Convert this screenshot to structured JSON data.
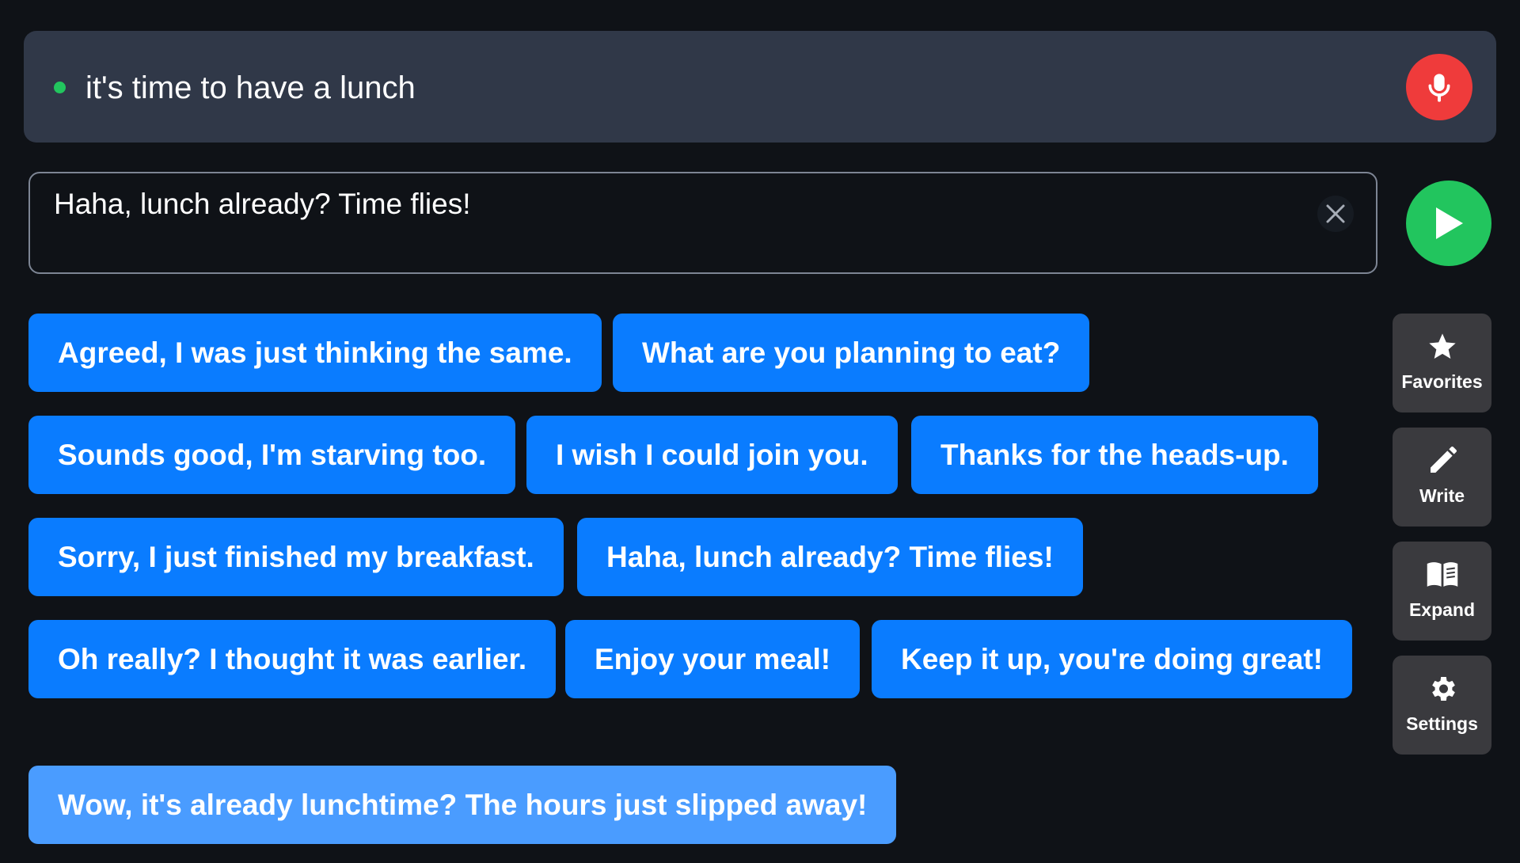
{
  "listen": {
    "transcript": "it's time to have a lunch",
    "status_color": "#22c55e",
    "mic_icon": "microphone-icon",
    "mic_color": "#ef3b3b"
  },
  "reply": {
    "text": "Haha, lunch already? Time flies!",
    "clear_icon": "close-icon",
    "play_icon": "play-icon",
    "play_color": "#22c55e"
  },
  "suggestions": [
    "Agreed, I was just thinking the same.",
    "What are you planning to eat?",
    "Sounds good, I'm starving too.",
    "I wish I could join you.",
    "Thanks for the heads-up.",
    "Sorry, I just finished my breakfast.",
    "Haha, lunch already? Time flies!",
    "Oh really? I thought it was earlier.",
    "Enjoy your meal!",
    "Keep it up, you're doing great!"
  ],
  "expanded_suggestion": "Wow, it's already lunchtime? The hours just slipped away!",
  "chip_color": "#0a7cff",
  "expanded_chip_color": "#4a9cff",
  "side_tools": [
    {
      "label": "Favorites",
      "icon": "star-icon"
    },
    {
      "label": "Write",
      "icon": "pencil-icon"
    },
    {
      "label": "Expand",
      "icon": "book-icon"
    },
    {
      "label": "Settings",
      "icon": "gear-icon"
    }
  ]
}
